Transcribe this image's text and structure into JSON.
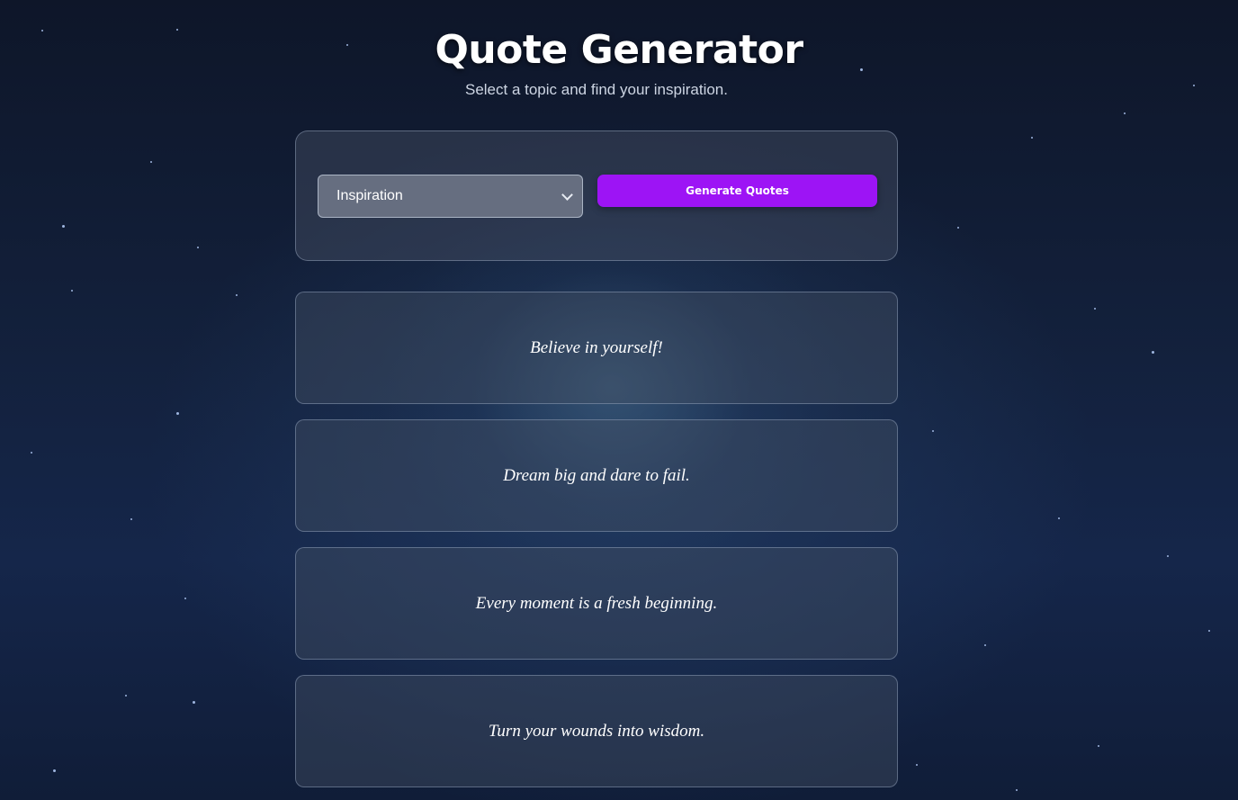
{
  "header": {
    "title": "Quote Generator",
    "subtitle": "Select a topic and find your inspiration."
  },
  "controls": {
    "topic_select": {
      "selected": "Inspiration"
    },
    "generate_label": "Generate Quotes"
  },
  "quotes": [
    {
      "text": "Believe in yourself!"
    },
    {
      "text": "Dream big and dare to fail."
    },
    {
      "text": "Every moment is a fresh beginning."
    },
    {
      "text": "Turn your wounds into wisdom."
    }
  ],
  "colors": {
    "accent": "#9d14f5",
    "background": "#13213d"
  },
  "icons": {
    "select_arrow": "chevron-down-icon"
  }
}
